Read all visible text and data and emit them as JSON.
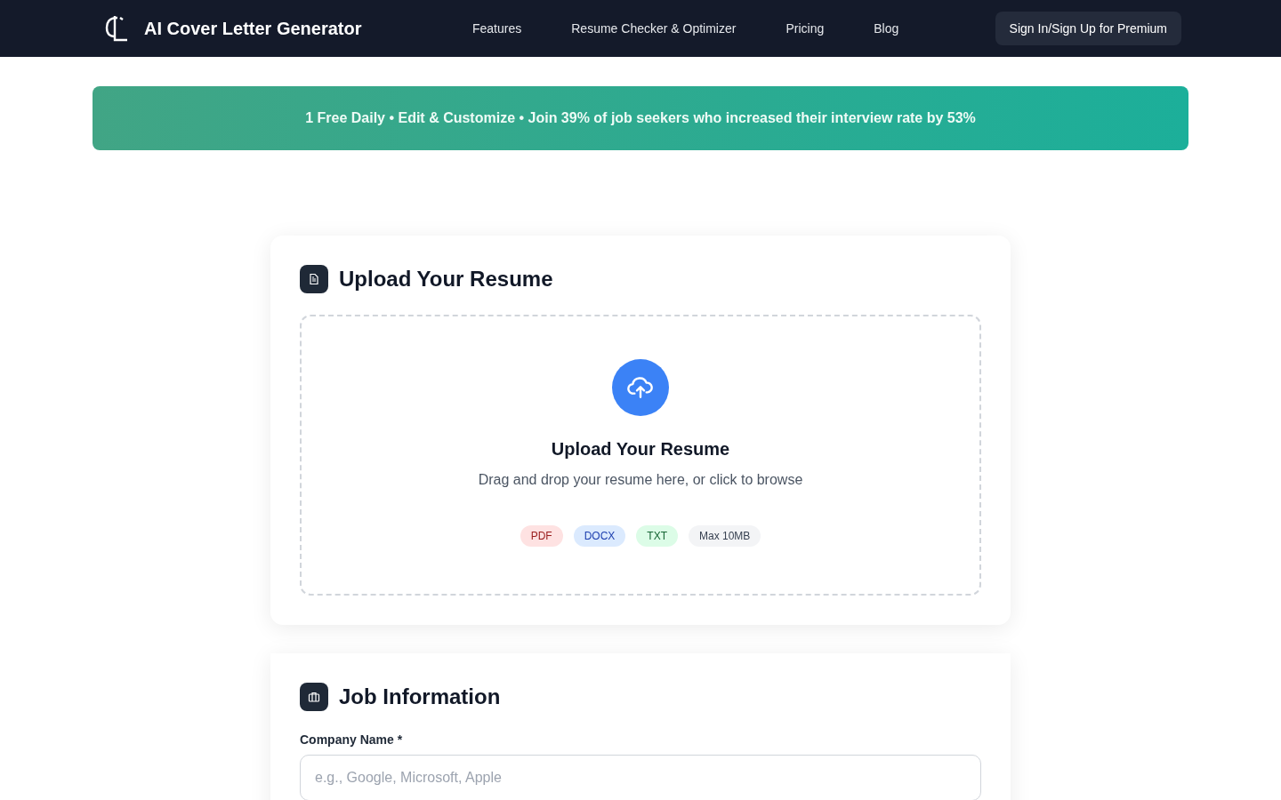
{
  "nav": {
    "brand": "AI Cover Letter Generator",
    "links": [
      "Features",
      "Resume Checker & Optimizer",
      "Pricing",
      "Blog"
    ],
    "cta": "Sign In/Sign Up for Premium"
  },
  "banner": {
    "text": "1 Free Daily • Edit & Customize • Join 39% of job seekers who increased their interview rate by 53%"
  },
  "upload_section": {
    "title": "Upload Your Resume",
    "dropzone": {
      "title": "Upload Your Resume",
      "hint": "Drag and drop your resume here, or click to browse",
      "chips": [
        {
          "label": "PDF",
          "kind": "pdf"
        },
        {
          "label": "DOCX",
          "kind": "docx"
        },
        {
          "label": "TXT",
          "kind": "txt"
        },
        {
          "label": "Max 10MB",
          "kind": "limit"
        }
      ]
    }
  },
  "job_section": {
    "title": "Job Information",
    "fields": [
      {
        "label": "Company Name *",
        "placeholder": "e.g., Google, Microsoft, Apple"
      }
    ]
  }
}
